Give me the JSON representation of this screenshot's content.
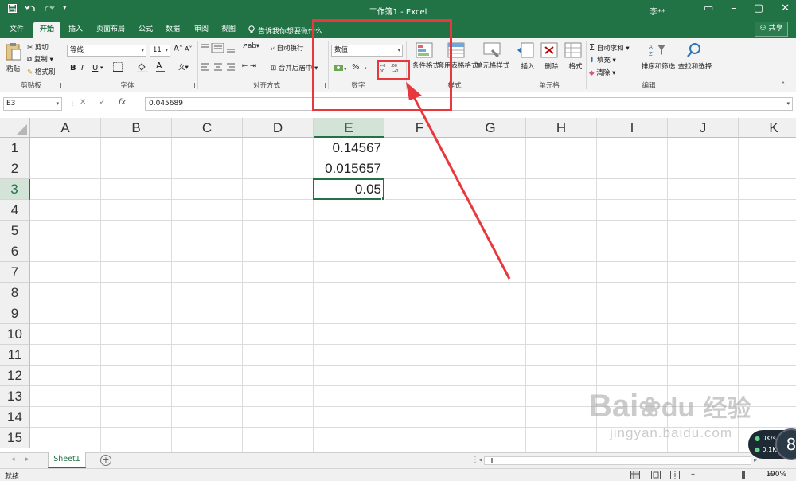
{
  "titlebar": {
    "title": "工作簿1 - Excel",
    "user": "李**",
    "save_icon": "save-icon",
    "undo_icon": "undo-icon",
    "redo_icon": "redo-icon"
  },
  "tabs": [
    {
      "label": "文件"
    },
    {
      "label": "开始"
    },
    {
      "label": "插入"
    },
    {
      "label": "页面布局"
    },
    {
      "label": "公式"
    },
    {
      "label": "数据"
    },
    {
      "label": "审阅"
    },
    {
      "label": "视图"
    }
  ],
  "tellme": "告诉我你想要做什么",
  "share": "共享",
  "ribbon": {
    "clipboard": {
      "paste": "粘贴",
      "cut": "剪切",
      "copy": "复制",
      "format_painter": "格式刷",
      "label": "剪贴板"
    },
    "font": {
      "name": "等线",
      "size": "11",
      "bold": "B",
      "italic": "I",
      "underline": "U",
      "grow": "A",
      "shrink": "A",
      "label": "字体"
    },
    "alignment": {
      "wrap": "自动换行",
      "merge": "合并后居中",
      "label": "对齐方式"
    },
    "number": {
      "format": "数值",
      "percent": "%",
      "comma": ",",
      "inc_decimal": ".00",
      "dec_decimal": ".0",
      "label": "数字"
    },
    "styles": {
      "conditional": "条件格式",
      "table": "套用表格格式",
      "cell_styles": "单元格样式",
      "label": "样式"
    },
    "cells": {
      "insert": "插入",
      "delete": "删除",
      "format": "格式",
      "label": "单元格"
    },
    "editing": {
      "autosum": "自动求和",
      "fill": "填充",
      "clear": "清除",
      "sort": "排序和筛选",
      "find": "查找和选择",
      "label": "编辑"
    }
  },
  "formula": {
    "namebox": "E3",
    "fx": "fx",
    "value": "0.045689"
  },
  "columns": [
    "A",
    "B",
    "C",
    "D",
    "E",
    "F",
    "G",
    "H",
    "I",
    "J",
    "K"
  ],
  "rows": [
    "1",
    "2",
    "3",
    "4",
    "5",
    "6",
    "7",
    "8",
    "9",
    "10",
    "11",
    "12",
    "13",
    "14",
    "15"
  ],
  "cells": {
    "E1": "0.14567",
    "E2": "0.015657",
    "E3": "0.05"
  },
  "sheet_tab": "Sheet1",
  "status": {
    "ready": "就绪",
    "zoom": "190%"
  },
  "watermark": {
    "line1": "Bai",
    "line2": "经验",
    "line3": "jingyan.baidu.com"
  },
  "network": {
    "down": "0K/s",
    "up": "0.1K/s",
    "ball": "8"
  },
  "colors": {
    "excel_green": "#217346",
    "annotation_red": "#e8383d"
  }
}
